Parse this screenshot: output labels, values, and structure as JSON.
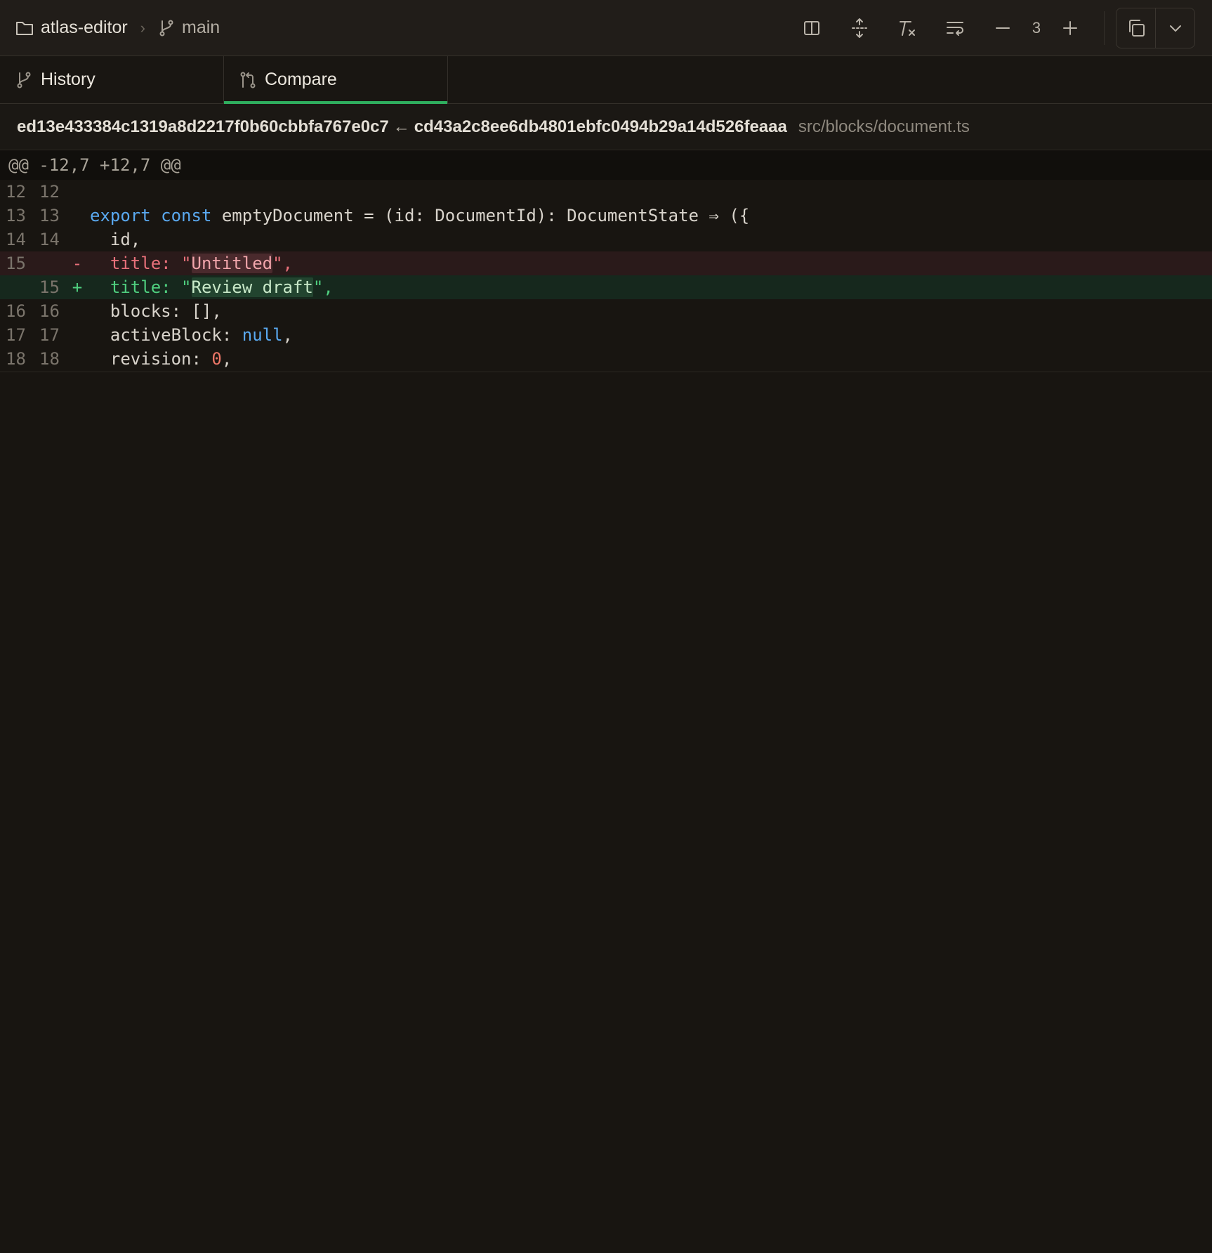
{
  "breadcrumb": {
    "repo": "atlas-editor",
    "separator": "›",
    "branch": "main"
  },
  "toolbar": {
    "context_lines": "3",
    "icons": [
      "split-view-icon",
      "expand-context-icon",
      "clear-format-icon",
      "wrap-lines-icon",
      "minus-icon",
      "plus-icon",
      "copy-icon",
      "chevron-down-icon"
    ]
  },
  "tabs": [
    {
      "label": "History",
      "icon": "branch-icon",
      "active": false
    },
    {
      "label": "Compare",
      "icon": "compare-icon",
      "active": true
    }
  ],
  "diff": {
    "base_sha": "ed13e433384c1319a8d2217f0b60cbbfa767e0c7",
    "arrow": "←",
    "head_sha": "cd43a2c8ee6db4801ebfc0494b29a14d526feaaa",
    "file_path": "src/blocks/document.ts",
    "hunk_header": "@@ -12,7 +12,7 @@",
    "lines": [
      {
        "old": "12",
        "new": "12",
        "type": "context",
        "text": ""
      },
      {
        "old": "13",
        "new": "13",
        "type": "context",
        "text": "export const emptyDocument = (id: DocumentId): DocumentState ⇒ ({"
      },
      {
        "old": "14",
        "new": "14",
        "type": "context",
        "text": "  id,"
      },
      {
        "old": "15",
        "new": "",
        "type": "del",
        "marker": "-",
        "text": "  title: \"Untitled\","
      },
      {
        "old": "",
        "new": "15",
        "type": "add",
        "marker": "+",
        "text": "  title: \"Review draft\","
      },
      {
        "old": "16",
        "new": "16",
        "type": "context",
        "text": "  blocks: [],"
      },
      {
        "old": "17",
        "new": "17",
        "type": "context",
        "text": "  activeBlock: null,"
      },
      {
        "old": "18",
        "new": "18",
        "type": "context",
        "text": "  revision: 0,"
      }
    ],
    "tokens": {
      "l13_kw1": "export",
      "l13_kw2": "const",
      "l13_rest": " emptyDocument = (id: DocumentId): DocumentState ⇒ ({",
      "l14": "  id,",
      "l15_pre": "  title: \"",
      "l15_hl": "Untitled",
      "l15_post": "\",",
      "l15n_pre": "  title: \"",
      "l15n_hl": "Review draft",
      "l15n_post": "\",",
      "l16": "  blocks: [],",
      "l17_pre": "  activeBlock: ",
      "l17_kw": "null",
      "l17_post": ",",
      "l18_pre": "  revision: ",
      "l18_num": "0",
      "l18_post": ","
    }
  },
  "colors": {
    "accent": "#2fae5e",
    "deleted": "#e8707a",
    "added": "#4fcf7f",
    "keyword": "#5aa9f0",
    "number": "#ec7667"
  }
}
